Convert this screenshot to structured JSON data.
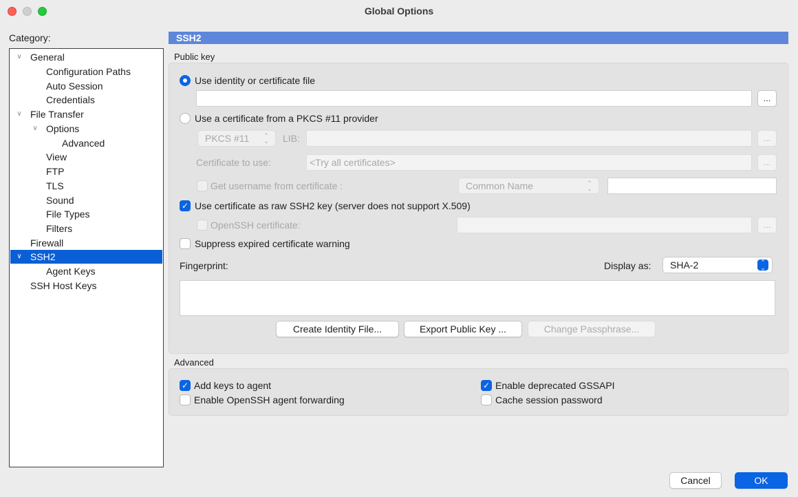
{
  "window": {
    "title": "Global Options"
  },
  "category": {
    "label": "Category:",
    "items": [
      {
        "label": "General",
        "expanded": true
      },
      {
        "label": "Configuration Paths"
      },
      {
        "label": "Auto Session"
      },
      {
        "label": "Credentials"
      },
      {
        "label": "File Transfer",
        "expanded": true
      },
      {
        "label": "Options",
        "expanded": true
      },
      {
        "label": "Advanced"
      },
      {
        "label": "View"
      },
      {
        "label": "FTP"
      },
      {
        "label": "TLS"
      },
      {
        "label": "Sound"
      },
      {
        "label": "File Types"
      },
      {
        "label": "Filters"
      },
      {
        "label": "Firewall"
      },
      {
        "label": "SSH2",
        "expanded": true,
        "selected": true
      },
      {
        "label": "Agent Keys"
      },
      {
        "label": "SSH Host Keys"
      }
    ]
  },
  "panel": {
    "header": "SSH2",
    "public_key": {
      "group_label": "Public key",
      "use_identity_label": "Use identity or certificate file",
      "identity_file_value": "",
      "browse_label": "...",
      "use_pkcs_label": "Use a certificate from a PKCS #11 provider",
      "pkcs_select": "PKCS #11",
      "lib_label": "LIB:",
      "lib_value": "",
      "cert_to_use_label": "Certificate to use:",
      "cert_to_use_placeholder": "<Try all certificates>",
      "get_username_label": "Get username from certificate :",
      "common_name_select": "Common Name",
      "username_value": "",
      "raw_ssh2_label": "Use certificate as raw SSH2 key (server does not support X.509)",
      "openssh_cert_label": "OpenSSH certificate:",
      "openssh_cert_value": "",
      "suppress_label": "Suppress expired certificate warning",
      "fingerprint_label": "Fingerprint:",
      "display_as_label": "Display as:",
      "display_as_value": "SHA-2",
      "fingerprint_value": "",
      "create_identity_label": "Create Identity File...",
      "export_public_key_label": "Export Public Key ...",
      "change_passphrase_label": "Change Passphrase..."
    },
    "advanced": {
      "group_label": "Advanced",
      "add_keys_label": "Add keys to agent",
      "enable_forwarding_label": "Enable OpenSSH agent forwarding",
      "enable_gssapi_label": "Enable deprecated GSSAPI",
      "cache_password_label": "Cache session password"
    }
  },
  "footer": {
    "cancel_label": "Cancel",
    "ok_label": "OK"
  },
  "colors": {
    "accent": "#0a64e4",
    "header": "#5e86da",
    "selection": "#0a5fd6"
  },
  "icons": {
    "checkmark": "check-icon",
    "expand": "chevron-down-icon",
    "stepper": "up-down-arrows-icon"
  }
}
